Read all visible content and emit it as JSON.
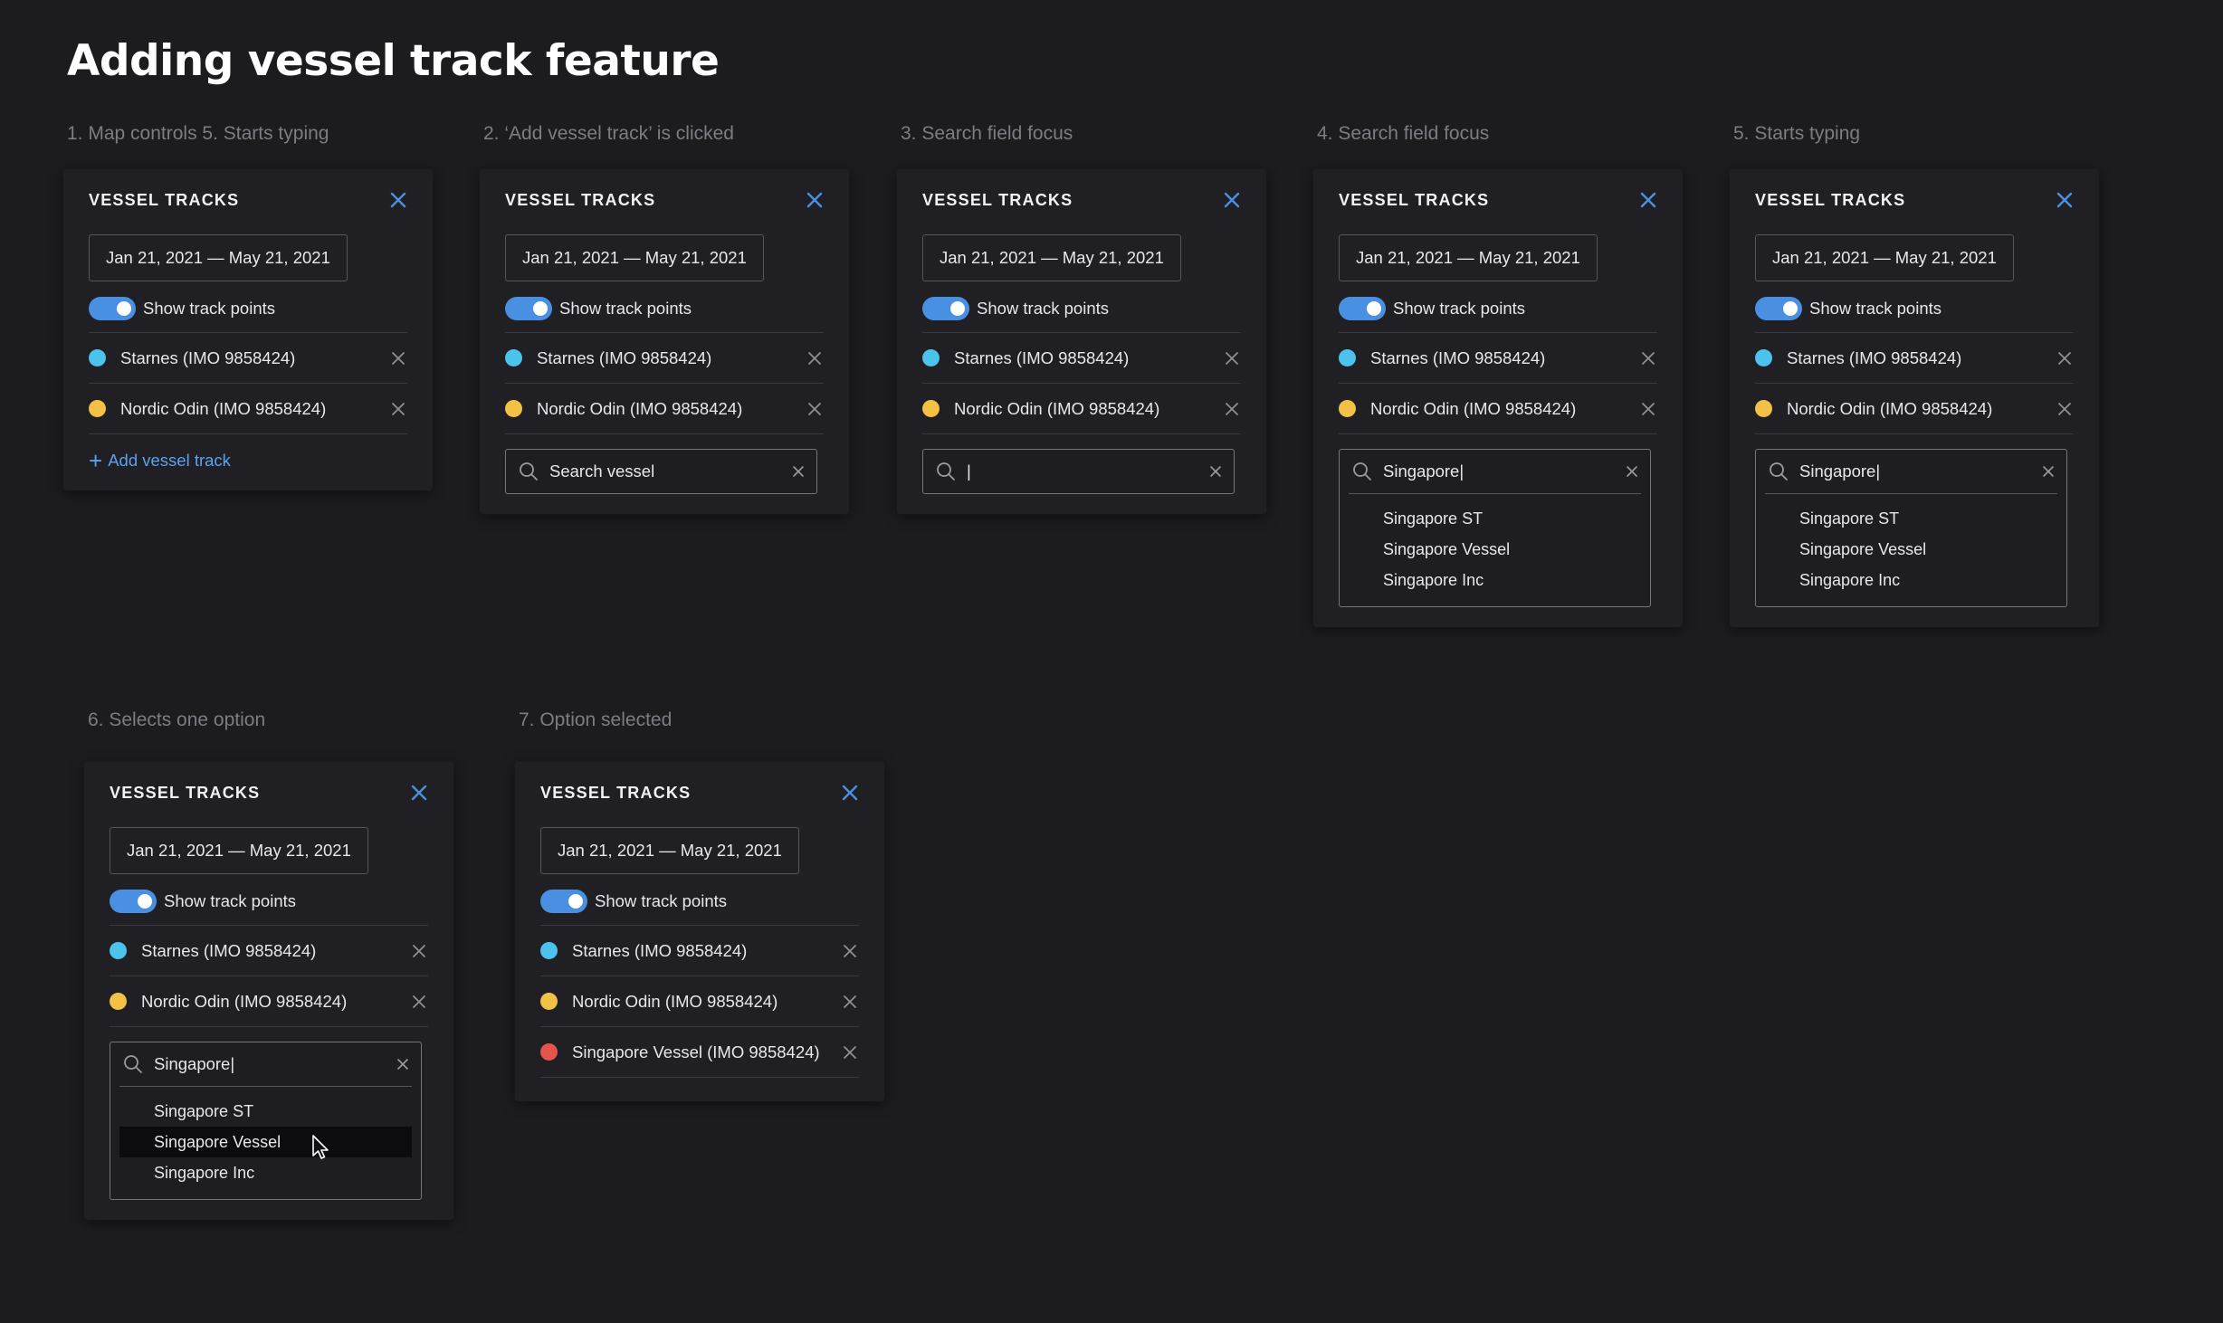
{
  "page": {
    "title": "Adding vessel track feature"
  },
  "colors": {
    "background": "#1c1c1f",
    "panel": "#202024",
    "accent_blue": "#4a90e2",
    "link_blue": "#5aa2f0",
    "dot_cyan": "#4cc3ec",
    "dot_yellow": "#f3c146",
    "dot_red": "#e5534b"
  },
  "panel_common": {
    "title": "VESSEL TRACKS",
    "date_range": "Jan 21, 2021 — May 21, 2021",
    "toggle_label": "Show track points",
    "toggle_on": true,
    "vessels": [
      {
        "name": "Starnes (IMO 9858424)",
        "color": "#4cc3ec"
      },
      {
        "name": "Nordic Odin (IMO 9858424)",
        "color": "#f3c146"
      }
    ],
    "add_label": "Add vessel track",
    "search_placeholder": "Search vessel",
    "search_cursor": "|",
    "search_query": "Singapore|",
    "options": [
      "Singapore ST",
      "Singapore Vessel",
      "Singapore Inc"
    ]
  },
  "steps": [
    {
      "label": "1. Map controls  5. Starts typing"
    },
    {
      "label": "2. ‘Add vessel track’ is clicked"
    },
    {
      "label": "3. Search field focus"
    },
    {
      "label": "4. Search field focus"
    },
    {
      "label": "5. Starts typing"
    },
    {
      "label": "6. Selects one option",
      "hovered_option": "Singapore Vessel"
    },
    {
      "label": "7. Option selected",
      "added_vessel": {
        "name": "Singapore Vessel (IMO 9858424)",
        "color": "#e5534b"
      }
    }
  ]
}
